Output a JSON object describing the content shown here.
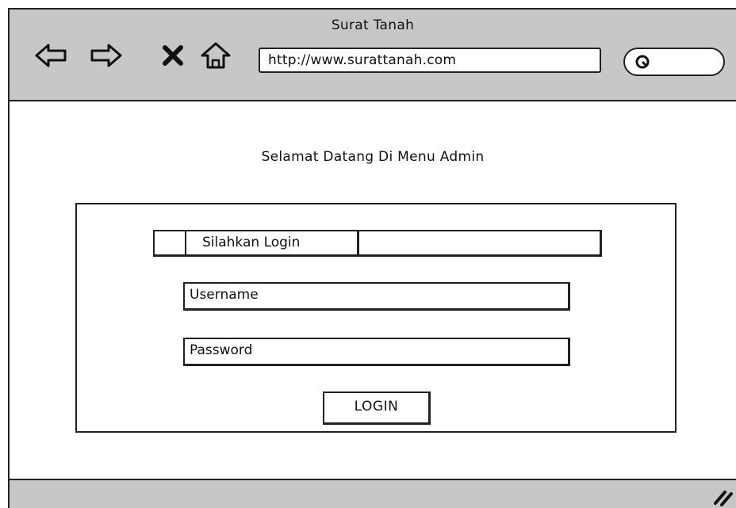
{
  "window": {
    "title": "Surat Tanah",
    "url": "http://www.surattanah.com",
    "nav_icons": [
      "back-arrow-icon",
      "forward-arrow-icon",
      "close-x-icon",
      "home-icon"
    ],
    "search_icon": "search-icon"
  },
  "page": {
    "welcome_text": "Selamat Datang Di Menu Admin"
  },
  "login": {
    "header_label": "Silahkan Login",
    "username_placeholder": "Username",
    "password_placeholder": "Password",
    "button_label": "LOGIN"
  },
  "statusbar": {
    "grip_icon": "resize-grip-icon"
  },
  "colors": {
    "chrome": "#c7c7c7",
    "outline": "#222222",
    "background": "#ffffff"
  }
}
